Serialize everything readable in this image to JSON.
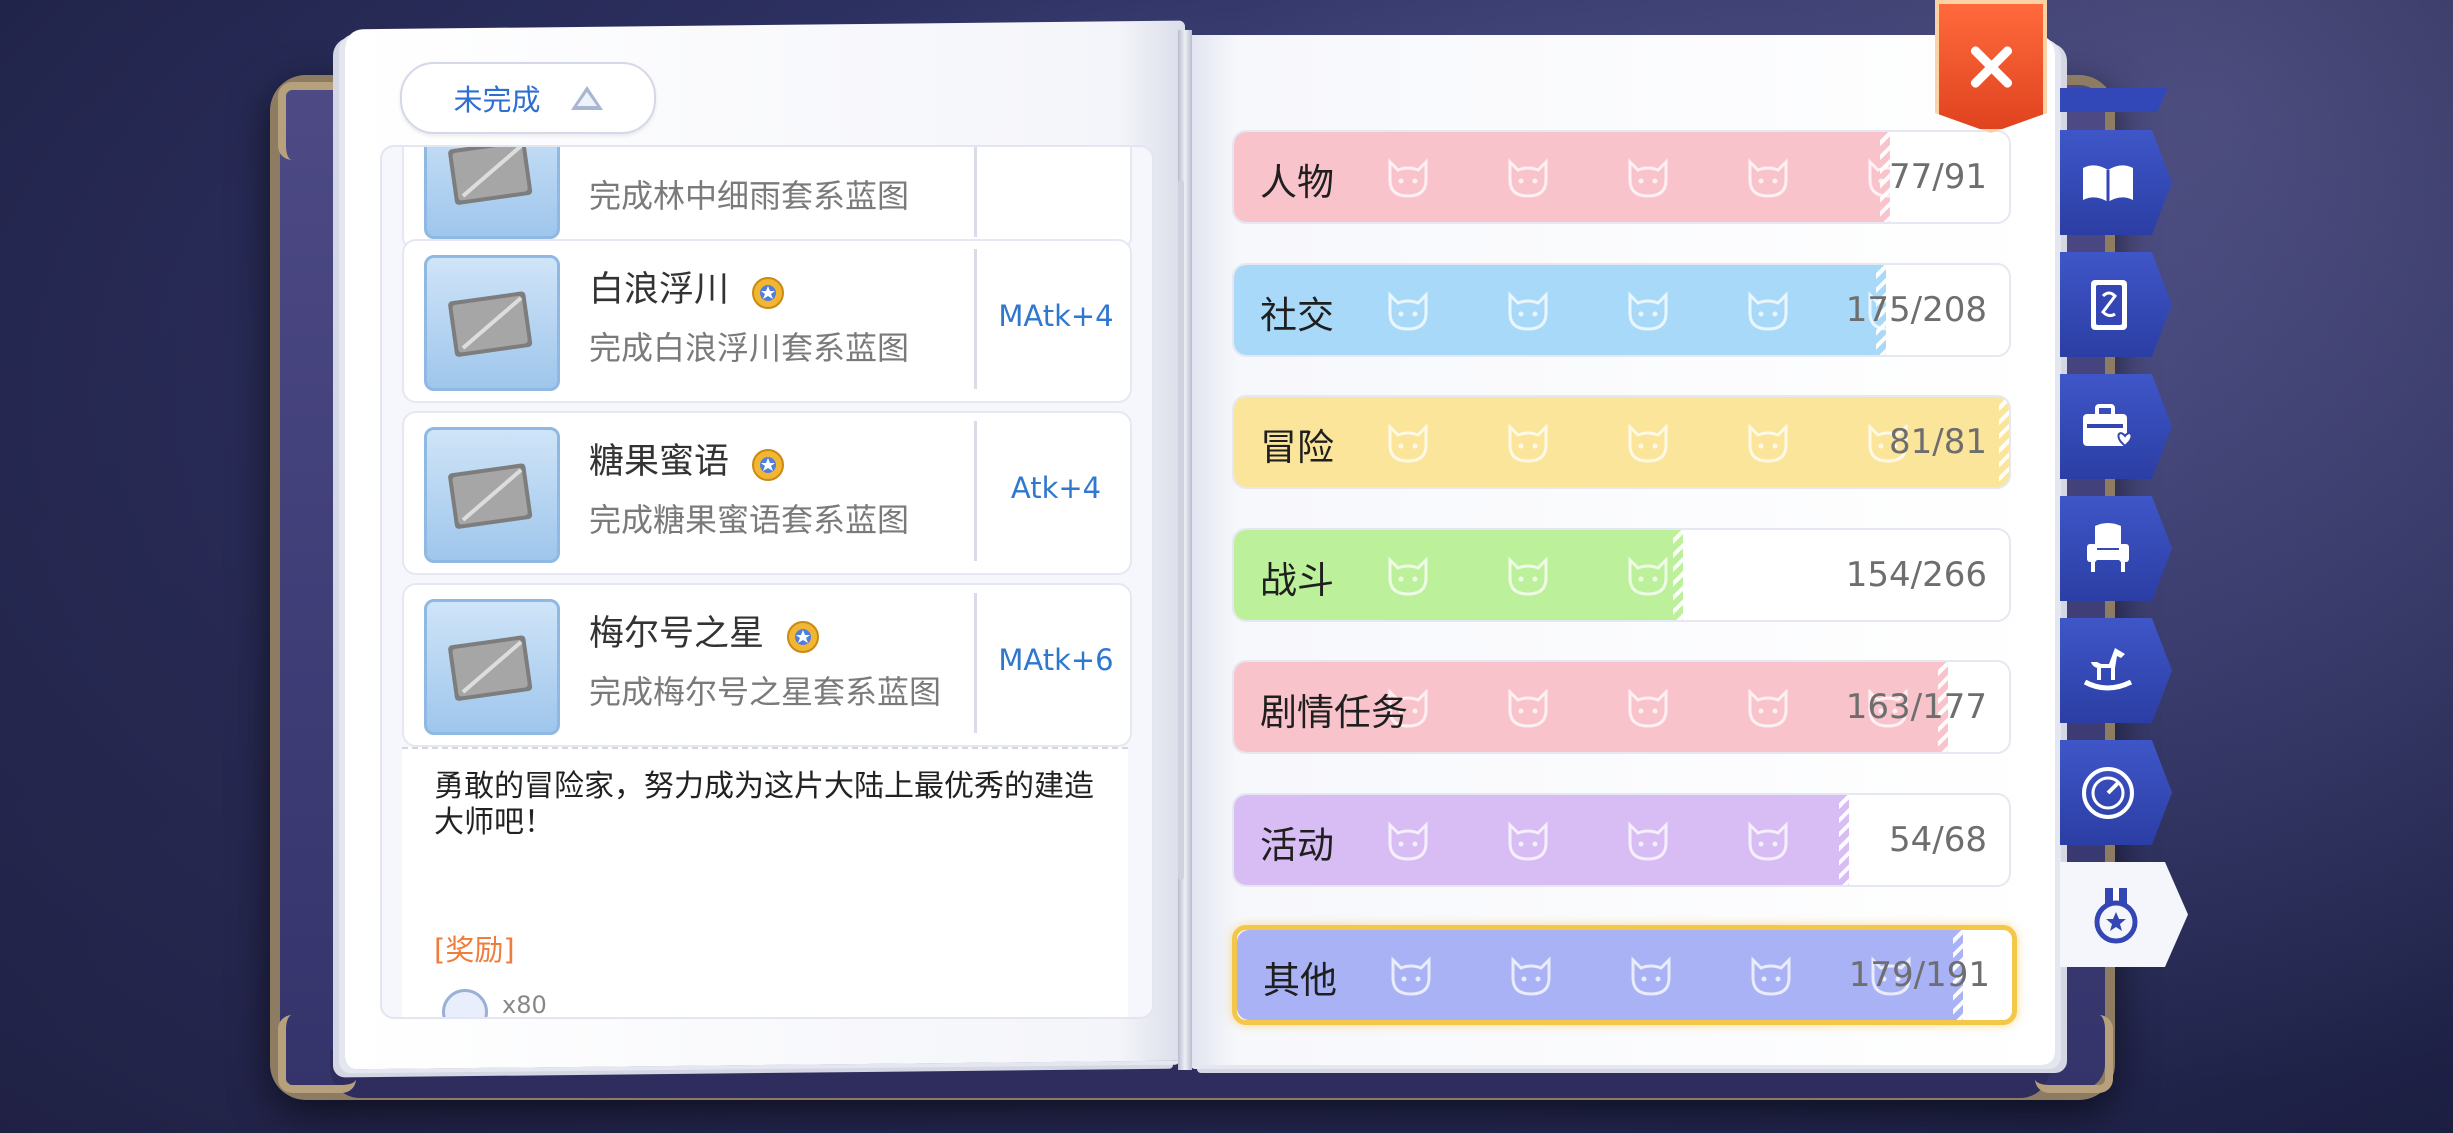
{
  "filter": {
    "label": "未完成"
  },
  "items": [
    {
      "name": "",
      "desc": "完成林中细雨套系蓝图",
      "stat": ""
    },
    {
      "name": "白浪浮川",
      "desc": "完成白浪浮川套系蓝图",
      "stat": "MAtk+4"
    },
    {
      "name": "糖果蜜语",
      "desc": "完成糖果蜜语套系蓝图",
      "stat": "Atk+4"
    },
    {
      "name": "梅尔号之星",
      "desc": "完成梅尔号之星套系蓝图",
      "stat": "MAtk+6"
    }
  ],
  "info": {
    "text": "勇敢的冒险家，努力成为这片大陆上最优秀的建造大师吧！",
    "reward_label": "[奖励]",
    "reward_qty": "x80"
  },
  "categories": [
    {
      "label": "人物",
      "count": "77/91",
      "progress": 0.846,
      "color": "#f9c3cc"
    },
    {
      "label": "社交",
      "count": "175/208",
      "progress": 0.841,
      "color": "#a9d9f8"
    },
    {
      "label": "冒险",
      "count": "81/81",
      "progress": 1.0,
      "color": "#fbe59b"
    },
    {
      "label": "战斗",
      "count": "154/266",
      "progress": 0.579,
      "color": "#bdf09a"
    },
    {
      "label": "剧情任务",
      "count": "163/177",
      "progress": 0.921,
      "color": "#f9c3cc"
    },
    {
      "label": "活动",
      "count": "54/68",
      "progress": 0.794,
      "color": "#d7bdf3"
    },
    {
      "label": "其他",
      "count": "179/191",
      "progress": 0.937,
      "color": "#a9b2f5"
    }
  ],
  "side_tabs": [
    {
      "icon": "open-book-icon"
    },
    {
      "icon": "card-icon"
    },
    {
      "icon": "briefcase-heart-icon"
    },
    {
      "icon": "armchair-icon"
    },
    {
      "icon": "rocking-horse-icon"
    },
    {
      "icon": "speed-dial-icon"
    },
    {
      "icon": "medal-icon",
      "active": true
    }
  ]
}
